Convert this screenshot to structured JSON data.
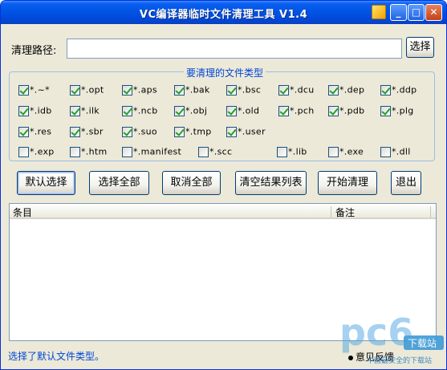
{
  "window": {
    "title": "VC编译器临时文件清理工具 V1.4"
  },
  "path": {
    "label": "清理路径:",
    "value": "",
    "browse_label": "选择"
  },
  "filetypes": {
    "group_title": "要清理的文件类型",
    "items": [
      {
        "label": "*.~*",
        "checked": true
      },
      {
        "label": "*.opt",
        "checked": true
      },
      {
        "label": "*.aps",
        "checked": true
      },
      {
        "label": "*.bak",
        "checked": true
      },
      {
        "label": "*.bsc",
        "checked": true
      },
      {
        "label": "*.dcu",
        "checked": true
      },
      {
        "label": "*.dep",
        "checked": true
      },
      {
        "label": "*.ddp",
        "checked": true
      },
      {
        "label": "*.idb",
        "checked": true
      },
      {
        "label": "*.ilk",
        "checked": true
      },
      {
        "label": "*.ncb",
        "checked": true
      },
      {
        "label": "*.obj",
        "checked": true
      },
      {
        "label": "*.old",
        "checked": true
      },
      {
        "label": "*.pch",
        "checked": true
      },
      {
        "label": "*.pdb",
        "checked": true
      },
      {
        "label": "*.plg",
        "checked": true
      },
      {
        "label": "*.res",
        "checked": true
      },
      {
        "label": "*.sbr",
        "checked": true
      },
      {
        "label": "*.suo",
        "checked": true
      },
      {
        "label": "*.tmp",
        "checked": true
      },
      {
        "label": "*.user",
        "checked": true
      },
      {
        "label": "*.exp",
        "checked": false
      },
      {
        "label": "*.htm",
        "checked": false
      },
      {
        "label": "*.manifest",
        "checked": false
      },
      {
        "label": "*.scc",
        "checked": false
      },
      {
        "label": "*.lib",
        "checked": false
      },
      {
        "label": "*.exe",
        "checked": false
      },
      {
        "label": "*.dll",
        "checked": false
      }
    ]
  },
  "actions": {
    "default_select": "默认选择",
    "select_all": "选择全部",
    "deselect_all": "取消全部",
    "clear_results": "清空结果列表",
    "start_clean": "开始清理",
    "exit": "退出"
  },
  "results": {
    "columns": [
      "条目",
      "备注"
    ],
    "rows": []
  },
  "status": {
    "text": "选择了默认文件类型。",
    "feedback": "意见反馈"
  },
  "watermark": {
    "brand": "pc6",
    "tag": "下载站",
    "slogan": "中国最安全的下载站"
  },
  "colors": {
    "titlebar": "#0055E5",
    "accent": "#0046D5",
    "check": "#21A121"
  }
}
